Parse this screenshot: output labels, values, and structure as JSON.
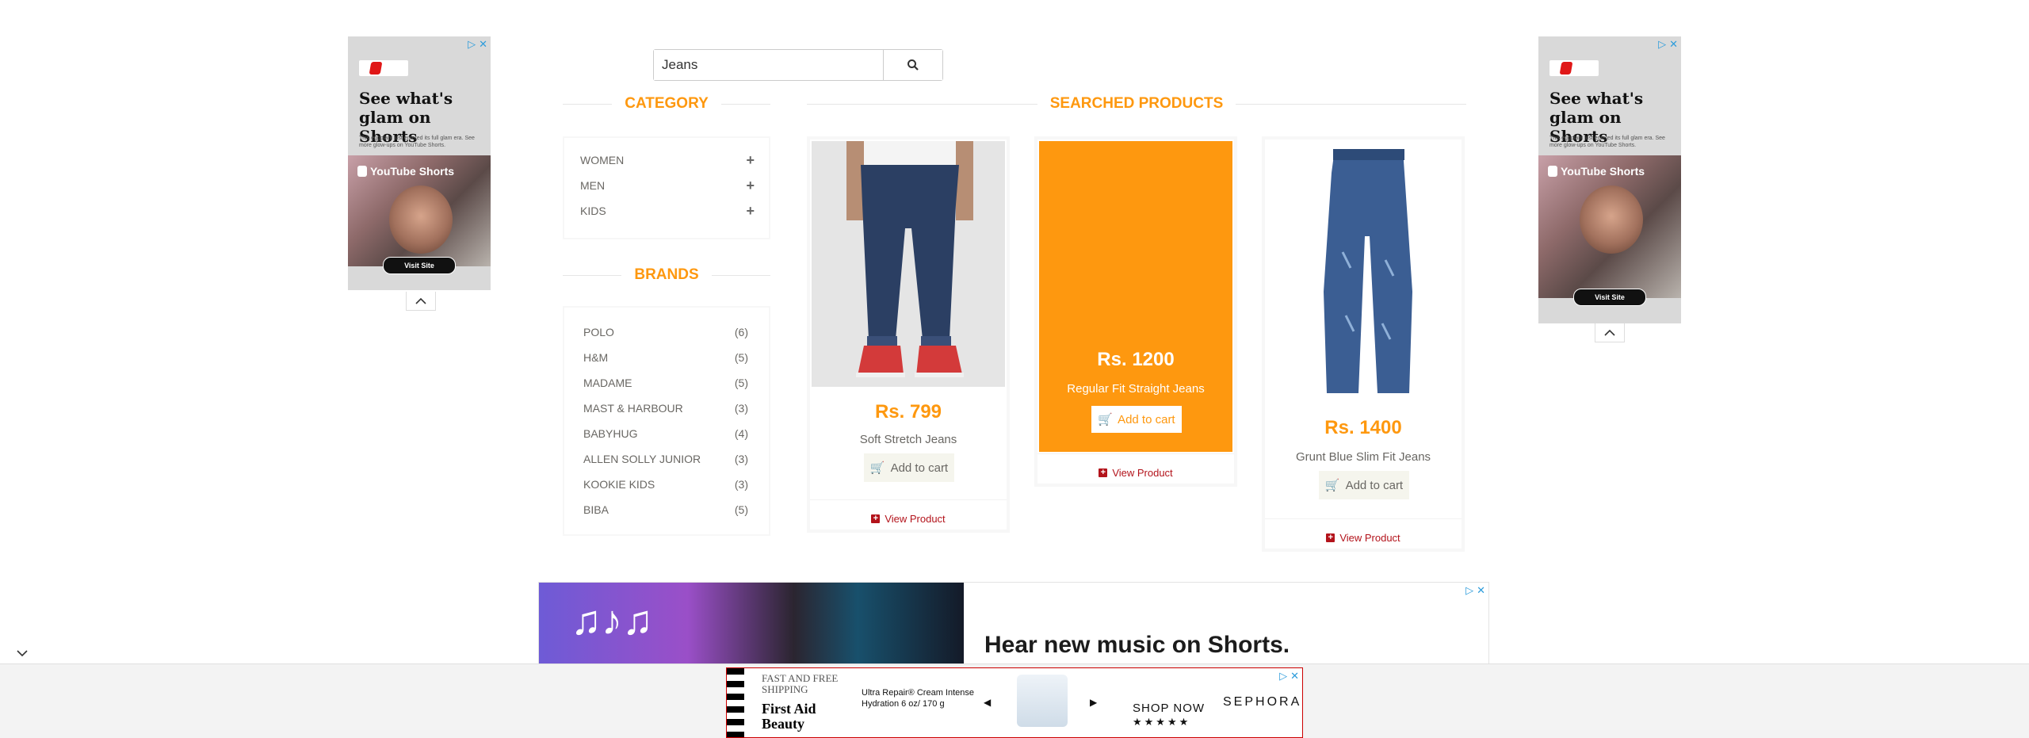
{
  "search": {
    "value": "Jeans"
  },
  "sections": {
    "category": "CATEGORY",
    "brands": "BRANDS",
    "searched": "SEARCHED PRODUCTS"
  },
  "categories": [
    {
      "label": "WOMEN",
      "icon": "plus-icon"
    },
    {
      "label": "MEN",
      "icon": "plus-icon"
    },
    {
      "label": "KIDS",
      "icon": "plus-icon"
    }
  ],
  "brands": [
    {
      "name": "POLO",
      "count": "(6)"
    },
    {
      "name": "H&M",
      "count": "(5)"
    },
    {
      "name": "MADAME",
      "count": "(5)"
    },
    {
      "name": "MAST & HARBOUR",
      "count": "(3)"
    },
    {
      "name": "BABYHUG",
      "count": "(4)"
    },
    {
      "name": "ALLEN SOLLY JUNIOR",
      "count": "(3)"
    },
    {
      "name": "KOOKIE KIDS",
      "count": "(3)"
    },
    {
      "name": "BIBA",
      "count": "(5)"
    }
  ],
  "products": [
    {
      "price": "Rs. 799",
      "name": "Soft Stretch Jeans",
      "cart": "Add to cart",
      "view": "View Product"
    },
    {
      "price": "Rs. 1200",
      "name": "Regular Fit Straight Jeans",
      "cart": "Add to cart",
      "view": "View Product"
    },
    {
      "price": "Rs. 1400",
      "name": "Grunt Blue Slim Fit Jeans",
      "cart": "Add to cart",
      "view": "View Product"
    }
  ],
  "ads": {
    "side": {
      "headline": "See what's glam on Shorts",
      "small": "This eggplant just entered its full glam era. See more glow-ups on YouTube Shorts.",
      "brand": "YouTube Shorts",
      "button": "Visit Site"
    },
    "music": {
      "headline": "Hear new music on Shorts."
    },
    "sephora": {
      "free": "FAST AND FREE SHIPPING",
      "first": "First Aid Beauty",
      "product": "Ultra Repair® Cream Intense Hydration 6 oz/ 170 g",
      "shop": "SHOP NOW",
      "stars": "★★★★★",
      "brand": "SEPHORA"
    }
  },
  "colors": {
    "accent": "#fe980f",
    "link": "#b3131b",
    "muted": "#696763"
  }
}
